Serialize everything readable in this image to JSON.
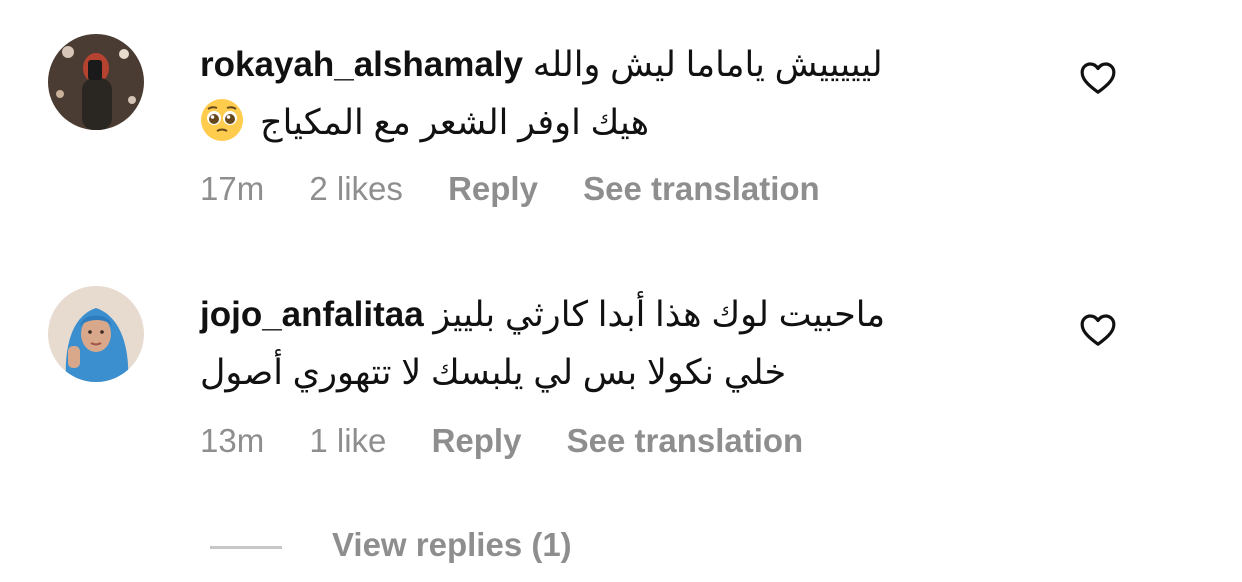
{
  "comments": [
    {
      "username": "rokayah_alshamaly",
      "text_line1": "ليييييش ياماما ليش والله",
      "text_line2": "هيك اوفر الشعر مع المكياج",
      "emoji": "pleading-face-emoji",
      "time": "17m",
      "likes": "2 likes",
      "reply_label": "Reply",
      "translate_label": "See translation"
    },
    {
      "username": "jojo_anfalitaa",
      "text_line1": "ماحبيت لوك هذا أبدا كارثي بلييز",
      "text_line2": "خلي نكولا بس لي يلبسك لا تتهوري أصول",
      "time": "13m",
      "likes": "1 like",
      "reply_label": "Reply",
      "translate_label": "See translation"
    }
  ],
  "view_replies": "View replies (1)",
  "colors": {
    "text": "#111111",
    "meta": "#8e8e8e",
    "emoji": "#ffcc4d",
    "hijab": "#3b8fcf"
  },
  "icons": [
    "heart-icon"
  ]
}
